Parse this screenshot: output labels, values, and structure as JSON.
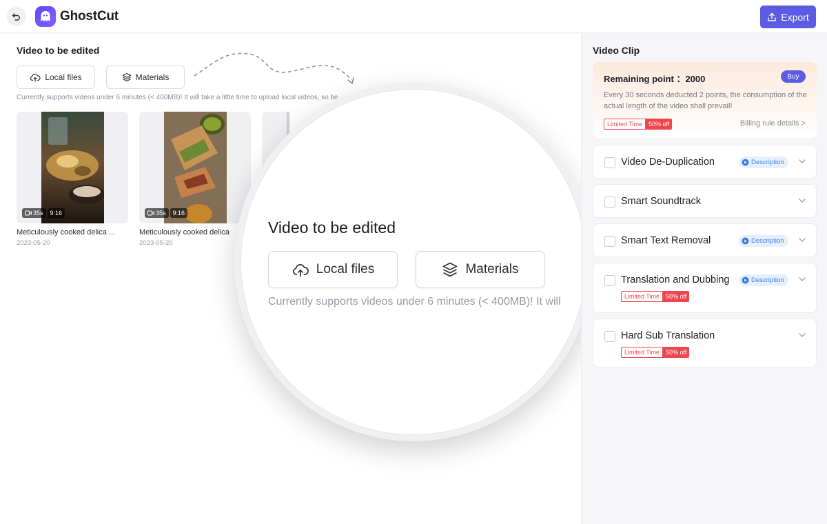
{
  "header": {
    "app_name": "GhostCut",
    "export_label": "Export"
  },
  "left": {
    "section_title": "Video to be edited",
    "local_files_label": "Local files",
    "materials_label": "Materials",
    "hint": "Currently supports videos under 6 minutes (< 400MB)! It will take a little time to upload local videos, so be",
    "videos": [
      {
        "duration": "35s",
        "ratio": "9:16",
        "title": "Meticulously cooked delica ...",
        "date": "2023-05-20"
      },
      {
        "duration": "35s",
        "ratio": "9:16",
        "title": "Meticulously cooked delica",
        "date": "2023-05-20"
      }
    ]
  },
  "magnifier": {
    "title": "Video to be edited",
    "local_files_label": "Local files",
    "materials_label": "Materials",
    "hint": "Currently supports videos under 6 minutes (< 400MB)! It will"
  },
  "right": {
    "title": "Video Clip",
    "points": {
      "label": "Remaining point ：2000",
      "buy_label": "Buy",
      "description": "Every 30 seconds deducted 2 points, the consumption of the actual length of the video shall prevail!",
      "limited_label": "Limited Time",
      "off_label": "50% off",
      "billing_label": "Billing rule details >"
    },
    "features": [
      {
        "name": "Video De-Duplication",
        "description_label": "Description"
      },
      {
        "name": "Smart Soundtrack"
      },
      {
        "name": "Smart Text Removal",
        "description_label": "Description"
      },
      {
        "name": "Translation and Dubbing",
        "description_label": "Description",
        "limited_label": "Limited Time",
        "off_label": "50% off"
      },
      {
        "name": "Hard Sub Translation",
        "limited_label": "Limited Time",
        "off_label": "50% off"
      }
    ]
  },
  "colors": {
    "accent": "#5b5ce2",
    "promo_red": "#f0464e",
    "description_blue": "#3b7de6"
  }
}
